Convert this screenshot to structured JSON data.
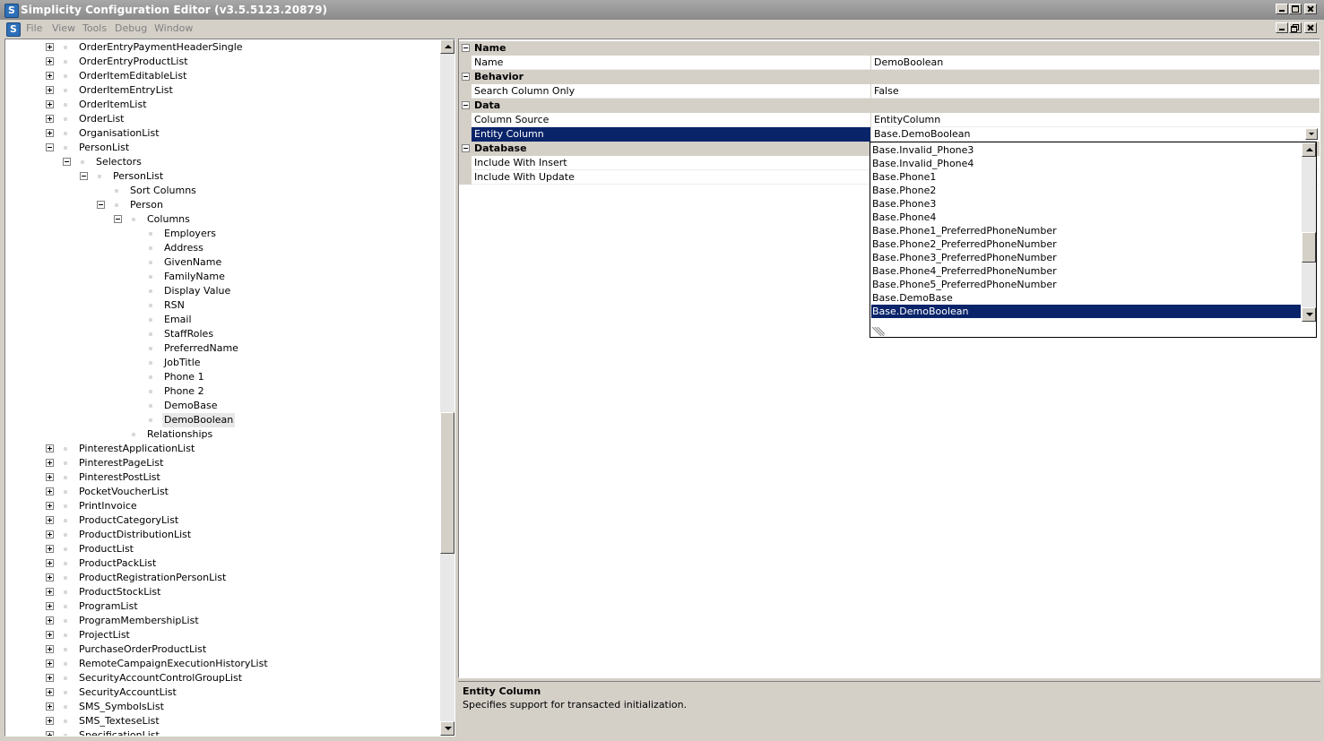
{
  "window": {
    "title": "Simplicity Configuration Editor (v3.5.5123.20879)",
    "icon": "S"
  },
  "menu": {
    "items": [
      "File",
      "View",
      "Tools",
      "Debug",
      "Window"
    ]
  },
  "tree": {
    "items": [
      {
        "label": "OrderEntryPaymentHeaderSingle",
        "level": 0,
        "expander": "plus"
      },
      {
        "label": "OrderEntryProductList",
        "level": 0,
        "expander": "plus"
      },
      {
        "label": "OrderItemEditableList",
        "level": 0,
        "expander": "plus"
      },
      {
        "label": "OrderItemEntryList",
        "level": 0,
        "expander": "plus"
      },
      {
        "label": "OrderItemList",
        "level": 0,
        "expander": "plus"
      },
      {
        "label": "OrderList",
        "level": 0,
        "expander": "plus"
      },
      {
        "label": "OrganisationList",
        "level": 0,
        "expander": "plus"
      },
      {
        "label": "PersonList",
        "level": 0,
        "expander": "minus"
      },
      {
        "label": "Selectors",
        "level": 1,
        "expander": "minus"
      },
      {
        "label": "PersonList",
        "level": 2,
        "expander": "minus"
      },
      {
        "label": "Sort Columns",
        "level": 3,
        "expander": "none"
      },
      {
        "label": "Person",
        "level": 3,
        "expander": "minus"
      },
      {
        "label": "Columns",
        "level": 4,
        "expander": "minus"
      },
      {
        "label": "Employers",
        "level": 5,
        "expander": "none"
      },
      {
        "label": "Address",
        "level": 5,
        "expander": "none"
      },
      {
        "label": "GivenName",
        "level": 5,
        "expander": "none"
      },
      {
        "label": "FamilyName",
        "level": 5,
        "expander": "none"
      },
      {
        "label": "Display Value",
        "level": 5,
        "expander": "none"
      },
      {
        "label": "RSN",
        "level": 5,
        "expander": "none"
      },
      {
        "label": "Email",
        "level": 5,
        "expander": "none"
      },
      {
        "label": "StaffRoles",
        "level": 5,
        "expander": "none"
      },
      {
        "label": "PreferredName",
        "level": 5,
        "expander": "none"
      },
      {
        "label": "JobTitle",
        "level": 5,
        "expander": "none"
      },
      {
        "label": "Phone 1",
        "level": 5,
        "expander": "none"
      },
      {
        "label": "Phone 2",
        "level": 5,
        "expander": "none"
      },
      {
        "label": "DemoBase",
        "level": 5,
        "expander": "none"
      },
      {
        "label": "DemoBoolean",
        "level": 5,
        "expander": "none",
        "selected": true
      },
      {
        "label": "Relationships",
        "level": 4,
        "expander": "none"
      },
      {
        "label": "PinterestApplicationList",
        "level": 0,
        "expander": "plus"
      },
      {
        "label": "PinterestPageList",
        "level": 0,
        "expander": "plus"
      },
      {
        "label": "PinterestPostList",
        "level": 0,
        "expander": "plus"
      },
      {
        "label": "PocketVoucherList",
        "level": 0,
        "expander": "plus"
      },
      {
        "label": "PrintInvoice",
        "level": 0,
        "expander": "plus"
      },
      {
        "label": "ProductCategoryList",
        "level": 0,
        "expander": "plus"
      },
      {
        "label": "ProductDistributionList",
        "level": 0,
        "expander": "plus"
      },
      {
        "label": "ProductList",
        "level": 0,
        "expander": "plus"
      },
      {
        "label": "ProductPackList",
        "level": 0,
        "expander": "plus"
      },
      {
        "label": "ProductRegistrationPersonList",
        "level": 0,
        "expander": "plus"
      },
      {
        "label": "ProductStockList",
        "level": 0,
        "expander": "plus"
      },
      {
        "label": "ProgramList",
        "level": 0,
        "expander": "plus"
      },
      {
        "label": "ProgramMembershipList",
        "level": 0,
        "expander": "plus"
      },
      {
        "label": "ProjectList",
        "level": 0,
        "expander": "plus"
      },
      {
        "label": "PurchaseOrderProductList",
        "level": 0,
        "expander": "plus"
      },
      {
        "label": "RemoteCampaignExecutionHistoryList",
        "level": 0,
        "expander": "plus"
      },
      {
        "label": "SecurityAccountControlGroupList",
        "level": 0,
        "expander": "plus"
      },
      {
        "label": "SecurityAccountList",
        "level": 0,
        "expander": "plus"
      },
      {
        "label": "SMS_SymbolsList",
        "level": 0,
        "expander": "plus"
      },
      {
        "label": "SMS_TexteseList",
        "level": 0,
        "expander": "plus"
      },
      {
        "label": "SpecificationList",
        "level": 0,
        "expander": "plus"
      }
    ]
  },
  "properties": {
    "rows": [
      {
        "kind": "category",
        "label": "Name"
      },
      {
        "kind": "prop",
        "name": "Name",
        "value": "DemoBoolean"
      },
      {
        "kind": "category",
        "label": "Behavior"
      },
      {
        "kind": "prop",
        "name": "Search Column Only",
        "value": "False"
      },
      {
        "kind": "category",
        "label": "Data"
      },
      {
        "kind": "prop",
        "name": "Column Source",
        "value": "EntityColumn"
      },
      {
        "kind": "prop",
        "name": "Entity Column",
        "value": "Base.DemoBoolean",
        "selected": true,
        "dropdown": true
      },
      {
        "kind": "category",
        "label": "Database"
      },
      {
        "kind": "prop",
        "name": "Include With Insert",
        "value": ""
      },
      {
        "kind": "prop",
        "name": "Include With Update",
        "value": ""
      }
    ]
  },
  "dropdown": {
    "options": [
      "Base.Invalid_Phone3",
      "Base.Invalid_Phone4",
      "Base.Phone1",
      "Base.Phone2",
      "Base.Phone3",
      "Base.Phone4",
      "Base.Phone1_PreferredPhoneNumber",
      "Base.Phone2_PreferredPhoneNumber",
      "Base.Phone3_PreferredPhoneNumber",
      "Base.Phone4_PreferredPhoneNumber",
      "Base.Phone5_PreferredPhoneNumber",
      "Base.DemoBase",
      "Base.DemoBoolean"
    ],
    "selected": "Base.DemoBoolean"
  },
  "description": {
    "title": "Entity Column",
    "text": "Specifies support for transacted initialization."
  },
  "colors": {
    "selection": "#0a246a",
    "chrome": "#d4d0c8",
    "titlebar": "#8a8a8a"
  }
}
